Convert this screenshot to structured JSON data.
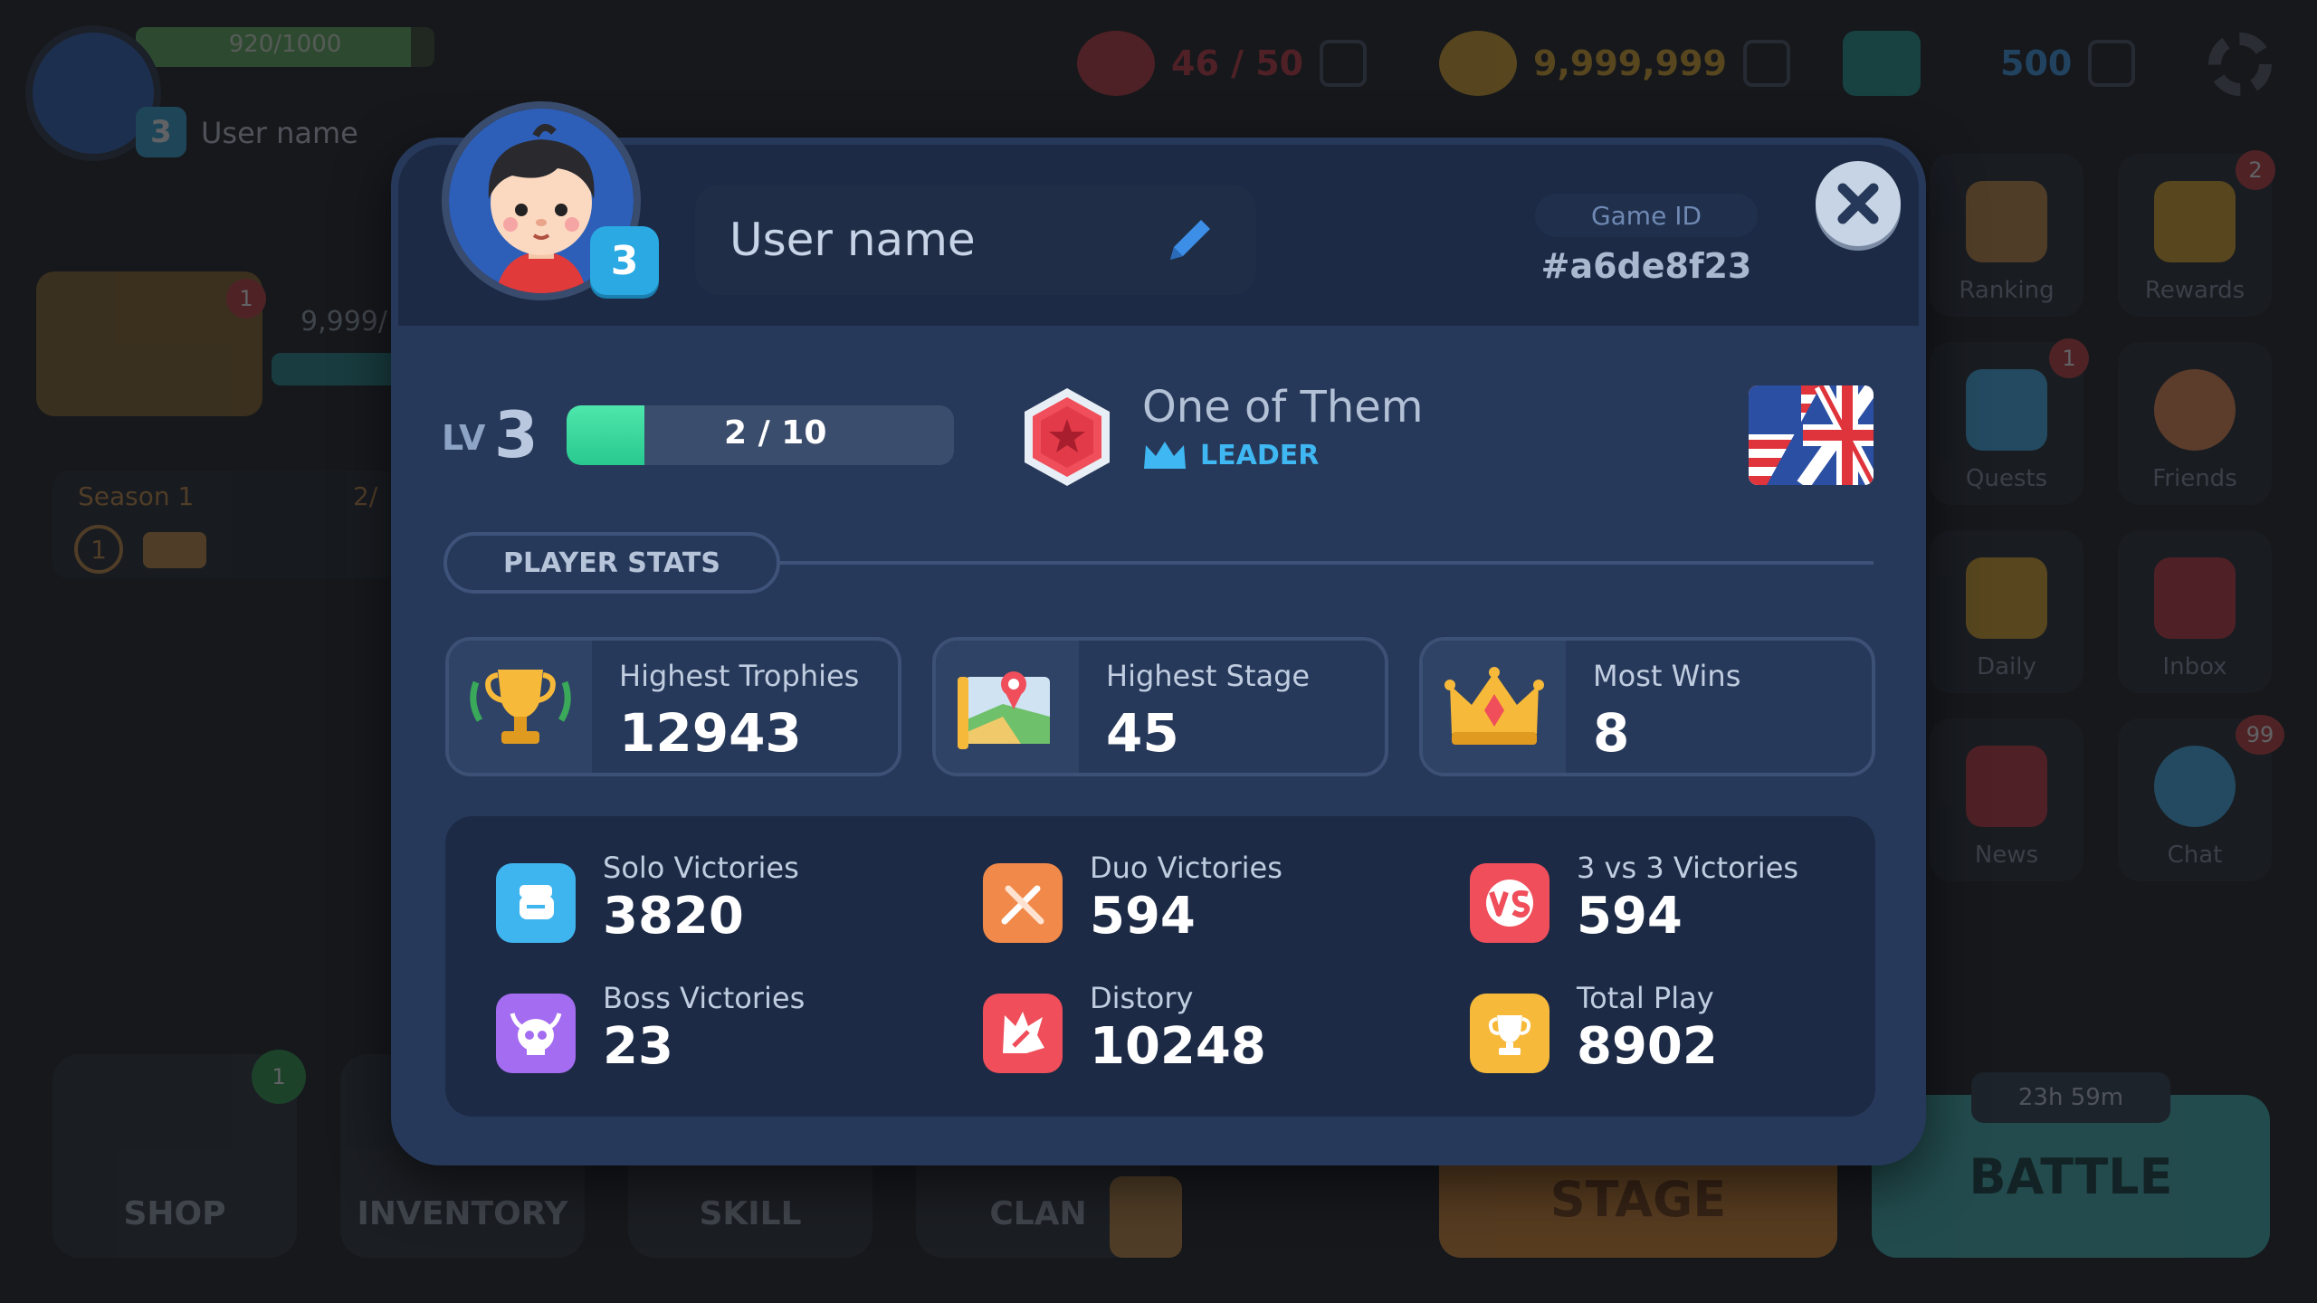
{
  "hud": {
    "xp_text": "920/1000",
    "xp_fraction": 0.92,
    "level": "3",
    "username": "User name",
    "lives": "46 / 50",
    "coins": "9,999,999",
    "gems": "500",
    "chest_count": "9,999/",
    "season_label": "Season 1",
    "season_progress": "2/",
    "season_level": "1",
    "side_buttons": [
      {
        "label": "Ranking",
        "badge": ""
      },
      {
        "label": "Rewards",
        "badge": "2"
      },
      {
        "label": "Quests",
        "badge": "1"
      },
      {
        "label": "Friends",
        "badge": ""
      },
      {
        "label": "Daily",
        "badge": ""
      },
      {
        "label": "Inbox",
        "badge": ""
      },
      {
        "label": "News",
        "badge": ""
      },
      {
        "label": "Chat",
        "badge": "99"
      }
    ],
    "bottom_buttons": [
      {
        "label": "SHOP",
        "badge": "1"
      },
      {
        "label": "INVENTORY",
        "badge": ""
      },
      {
        "label": "SKILL",
        "badge": ""
      },
      {
        "label": "CLAN",
        "badge": ""
      }
    ],
    "stage_label": "STAGE",
    "battle_label": "BATTLE",
    "battle_timer": "23h 59m"
  },
  "profile": {
    "avatar_level": "3",
    "username": "User name",
    "game_id_label": "Game ID",
    "game_id": "#a6de8f23",
    "lv_label": "LV",
    "level": "3",
    "xp_text": "2 / 10",
    "xp_fraction": 0.2,
    "title_name": "One of Them",
    "title_role": "LEADER",
    "stats_header": "PLAYER STATS",
    "highlights": [
      {
        "label": "Highest Trophies",
        "value": "12943",
        "icon": "trophy-icon"
      },
      {
        "label": "Highest Stage",
        "value": "45",
        "icon": "map-icon"
      },
      {
        "label": "Most Wins",
        "value": "8",
        "icon": "crown-icon"
      }
    ],
    "stats": [
      {
        "label": "Solo Victories",
        "value": "3820",
        "icon": "fist-icon",
        "color": "#3fb5ef"
      },
      {
        "label": "Duo Victories",
        "value": "594",
        "icon": "swords-icon",
        "color": "#f0894a"
      },
      {
        "label": "3 vs 3 Victories",
        "value": "594",
        "icon": "vs-icon",
        "color": "#ef4e5a"
      },
      {
        "label": "Boss Victories",
        "value": "23",
        "icon": "skull-icon",
        "color": "#a46cf0"
      },
      {
        "label": "Distory",
        "value": "10248",
        "icon": "destroy-icon",
        "color": "#ef4e5a"
      },
      {
        "label": "Total Play",
        "value": "8902",
        "icon": "cup-icon",
        "color": "#f7b93a"
      }
    ]
  },
  "colors": {
    "modal_bg": "#27395a",
    "header_bg": "#1c2a45",
    "xp_green": "#35d79d",
    "accent_blue": "#2aa9e3"
  }
}
